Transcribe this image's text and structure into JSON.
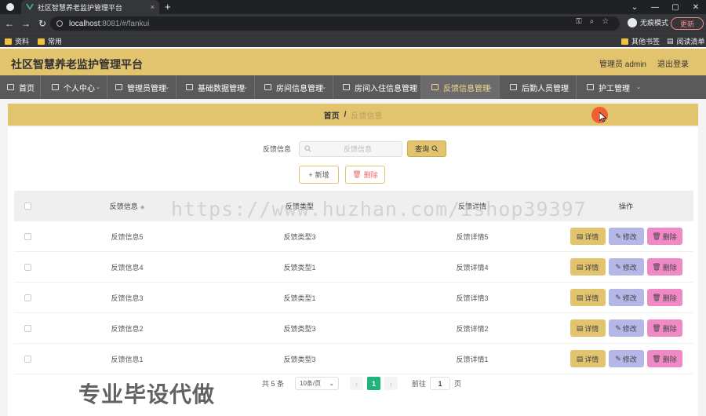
{
  "browser": {
    "tab_title": "社区智慧养老监护管理平台",
    "new_tab": "+",
    "tab_close": "×",
    "url_host": "localhost",
    "url_path": ":8081/#/fankui",
    "incognito_label": "无痕模式",
    "update_label": "更新",
    "bookmarks": [
      "资料",
      "常用"
    ],
    "other_bookmarks": "其他书签",
    "reading_list": "阅读清单",
    "window_controls": [
      "⌄",
      "—",
      "▢",
      "✕"
    ]
  },
  "app": {
    "title": "社区智慧养老监护管理平台",
    "user": "管理员 admin",
    "logout": "退出登录"
  },
  "nav": [
    {
      "label": "首页",
      "icon": "home-icon",
      "dropdown": false
    },
    {
      "label": "个人中心",
      "icon": "user-icon",
      "dropdown": true
    },
    {
      "label": "管理员管理",
      "icon": "admin-icon",
      "dropdown": true
    },
    {
      "label": "基础数据管理",
      "icon": "data-icon",
      "dropdown": true
    },
    {
      "label": "房间信息管理",
      "icon": "grid-icon",
      "dropdown": true
    },
    {
      "label": "房间入住信息管理",
      "icon": "checkin-icon",
      "dropdown": true
    },
    {
      "label": "反馈信息管理",
      "icon": "feedback-icon",
      "dropdown": true,
      "active": true
    },
    {
      "label": "后勤人员管理",
      "icon": "staff-icon",
      "dropdown": true
    },
    {
      "label": "护工管理",
      "icon": "nurse-icon",
      "dropdown": true
    }
  ],
  "breadcrumb": {
    "home": "首页",
    "separator": "/",
    "current": "反馈信息"
  },
  "search": {
    "label": "反馈信息",
    "placeholder": "反馈信息",
    "button": "查询"
  },
  "actions": {
    "add": "新增",
    "delete": "删除"
  },
  "table": {
    "headers": [
      "反馈信息",
      "反馈类型",
      "反馈详情",
      "操作"
    ],
    "rows": [
      [
        "反馈信息5",
        "反馈类型3",
        "反馈详情5"
      ],
      [
        "反馈信息4",
        "反馈类型1",
        "反馈详情4"
      ],
      [
        "反馈信息3",
        "反馈类型1",
        "反馈详情3"
      ],
      [
        "反馈信息2",
        "反馈类型3",
        "反馈详情2"
      ],
      [
        "反馈信息1",
        "反馈类型3",
        "反馈详情1"
      ]
    ],
    "row_buttons": {
      "detail": "详情",
      "edit": "修改",
      "delete": "删除"
    }
  },
  "pagination": {
    "total": "共 5 条",
    "page_size": "10条/页",
    "current": "1",
    "goto": "前往",
    "goto_value": "1",
    "page_unit": "页"
  },
  "overlays": {
    "watermark": "https://www.huzhan.com/ishop39397",
    "promo": "专业毕设代做"
  },
  "colors": {
    "header": "#e2c36e",
    "nav": "#5a5a5a",
    "detail_btn": "#e2c36e",
    "edit_btn": "#b5b8e6",
    "delete_btn": "#f08ac6",
    "pager_active": "#21b37a"
  }
}
